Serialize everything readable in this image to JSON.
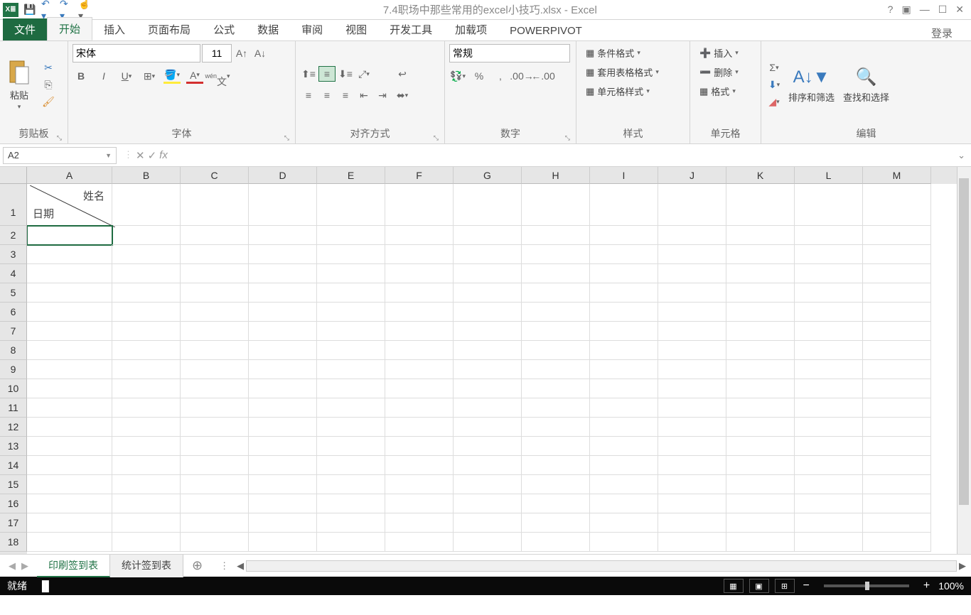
{
  "title": "7.4职场中那些常用的excel小技巧.xlsx - Excel",
  "login": "登录",
  "tabs": {
    "file": "文件",
    "home": "开始",
    "insert": "插入",
    "layout": "页面布局",
    "formulas": "公式",
    "data": "数据",
    "review": "审阅",
    "view": "视图",
    "developer": "开发工具",
    "addins": "加载项",
    "powerpivot": "POWERPIVOT"
  },
  "ribbon": {
    "clipboard": {
      "label": "剪贴板",
      "paste": "粘贴"
    },
    "font": {
      "label": "字体",
      "name": "宋体",
      "size": "11"
    },
    "alignment": {
      "label": "对齐方式"
    },
    "number": {
      "label": "数字",
      "format": "常规"
    },
    "styles": {
      "label": "样式",
      "conditional": "条件格式",
      "tableformat": "套用表格格式",
      "cellstyles": "单元格样式"
    },
    "cells": {
      "label": "单元格",
      "insert": "插入",
      "delete": "删除",
      "format": "格式"
    },
    "editing": {
      "label": "编辑",
      "sort": "排序和筛选",
      "find": "查找和选择"
    }
  },
  "formula_bar": {
    "name_box": "A2",
    "formula": ""
  },
  "grid": {
    "columns": [
      "A",
      "B",
      "C",
      "D",
      "E",
      "F",
      "G",
      "H",
      "I",
      "J",
      "K",
      "L",
      "M"
    ],
    "rows": [
      1,
      2,
      3,
      4,
      5,
      6,
      7,
      8,
      9,
      10,
      11,
      12,
      13,
      14,
      15,
      16,
      17,
      18
    ],
    "a1_top": "姓名",
    "a1_bottom": "日期",
    "selected": "A2"
  },
  "sheets": {
    "active": "印刷签到表",
    "other": "统计签到表"
  },
  "status": {
    "ready": "就绪",
    "zoom": "100%"
  }
}
